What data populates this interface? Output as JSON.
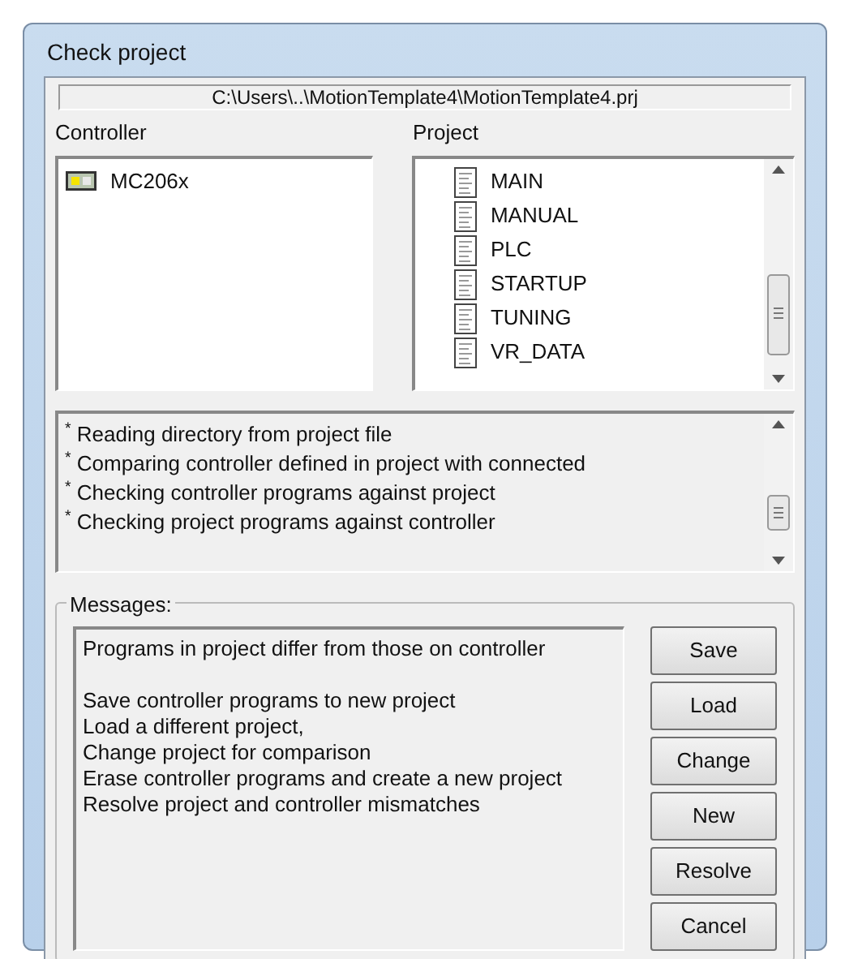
{
  "window": {
    "title": "Check project"
  },
  "path": "C:\\Users\\..\\MotionTemplate4\\MotionTemplate4.prj",
  "controller": {
    "label": "Controller",
    "items": [
      {
        "name": "MC206x"
      }
    ]
  },
  "project": {
    "label": "Project",
    "items": [
      {
        "name": "MAIN"
      },
      {
        "name": "MANUAL"
      },
      {
        "name": "PLC"
      },
      {
        "name": "STARTUP"
      },
      {
        "name": "TUNING"
      },
      {
        "name": "VR_DATA"
      }
    ]
  },
  "log": [
    "$^{*}$ Reading directory from project file",
    "$^{*}$ Comparing controller defined in project with connected",
    "$^{*}$ Checking controller programs against project",
    "$^{*}$ Checking project programs against controller"
  ],
  "messages": {
    "label": "Messages:",
    "headline": "Programs in project differ from those on controller",
    "lines": [
      "Save controller programs to new project",
      "Load a different project,",
      "Change project for comparison",
      "Erase controller programs and create a new project",
      "Resolve project and controller mismatches"
    ]
  },
  "buttons": [
    "Save",
    "Load",
    "Change",
    "New",
    "Resolve",
    "Cancel"
  ]
}
